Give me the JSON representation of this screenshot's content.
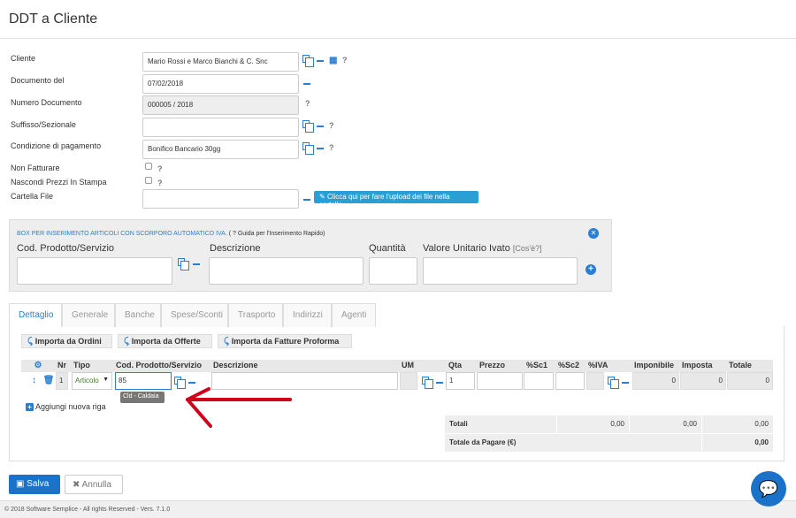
{
  "page": {
    "title": "DDT a Cliente"
  },
  "form": {
    "cliente": {
      "label": "Cliente",
      "value": "Mario Rossi e Marco Bianchi & C. Snc"
    },
    "documento_del": {
      "label": "Documento del",
      "value": "07/02/2018"
    },
    "numero_documento": {
      "label": "Numero Documento",
      "value": "000005 / 2018"
    },
    "suffisso": {
      "label": "Suffisso/Sezionale",
      "value": ""
    },
    "condizione": {
      "label": "Condizione di pagamento",
      "value": "Bonifico Bancario 30gg"
    },
    "non_fatturare": {
      "label": "Non Fatturare"
    },
    "nascondi_prezzi": {
      "label": "Nascondi Prezzi In Stampa"
    },
    "cartella_file": {
      "label": "Cartella File",
      "value": ""
    },
    "upload_label": "Clicca qui per fare l'upload dei file nella cartella",
    "question": "?"
  },
  "box": {
    "title": "BOX PER INSERIMENTO ARTICOLI CON SCORPORO AUTOMATICO IVA.",
    "guide": "( ? Guida per l'Inserimento Rapido)",
    "cod_label": "Cod. Prodotto/Servizio",
    "desc_label": "Descrizione",
    "qty_label": "Quantità",
    "price_label": "Valore Unitario Ivato",
    "price_hint": "[Cos'è?]"
  },
  "tabs": [
    "Dettaglio",
    "Generale",
    "Banche",
    "Spese/Sconti",
    "Trasporto",
    "Indirizzi",
    "Agenti"
  ],
  "actions": {
    "importa_ordini": "Importa da Ordini",
    "importa_offerte": "Importa da Offerte",
    "importa_proforma": "Importa da Fatture Proforma",
    "aggiungi_riga": "Aggiungi nuova riga"
  },
  "table": {
    "headers": [
      "Nr",
      "Tipo",
      "Cod. Prodotto/Servizio",
      "Descrizione",
      "UM",
      "Qta",
      "Prezzo",
      "%Sc1",
      "%Sc2",
      "%IVA",
      "Imponibile",
      "Imposta",
      "Totale"
    ],
    "row": {
      "nr": "1",
      "tipo": "Articolo",
      "cod": "85",
      "qta": "1",
      "imponibile": "0",
      "imposta": "0",
      "totale": "0"
    },
    "suggestion": "Cld - Caldaia"
  },
  "totals": {
    "totali_label": "Totali",
    "v1": "0,00",
    "v2": "0,00",
    "v3": "0,00",
    "da_pagare_label": "Totale da Pagare (€)",
    "da_pagare": "0,00"
  },
  "buttons": {
    "salva": "Salva",
    "annulla": "Annulla"
  },
  "footer": {
    "text": "© 2018 Software Semplice - All rights Reserved - Vers. 7.1.0"
  },
  "colors": {
    "accent": "#2a7fd4",
    "annotation": "#d0021b"
  }
}
